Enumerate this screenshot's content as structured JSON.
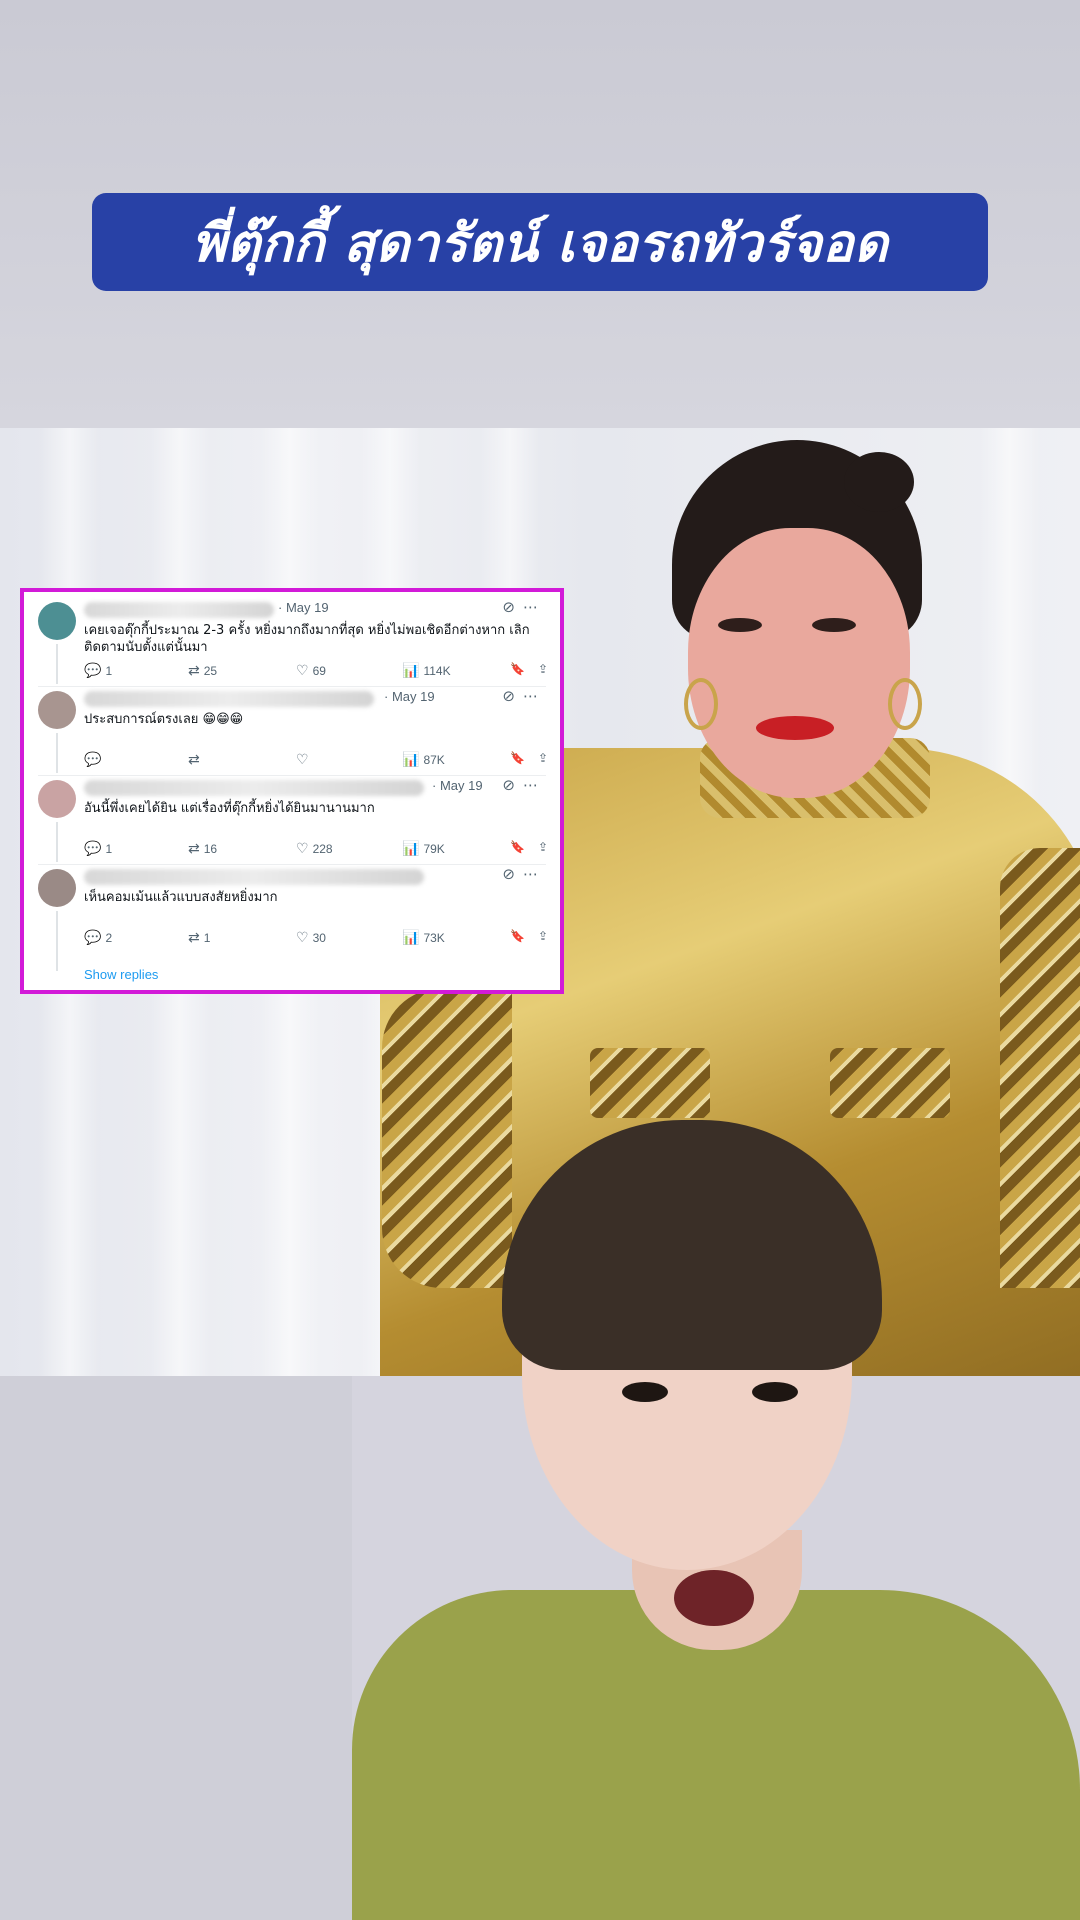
{
  "title": "พี่ตุ๊กกี้ สุดารัตน์ เจอรถทัวร์จอด",
  "comments": [
    {
      "date": "· May 19",
      "text": "เคยเจอตุ๊กกี้ประมาณ 2-3 ครั้ง หยิ่งมากถึงมากที่สุด หยิ่งไม่พอเชิดอีกต่างหาก เลิกติดตามนับตั้งแต่นั้นมา",
      "replies": "1",
      "reposts": "25",
      "likes": "69",
      "views": "114K",
      "avatar_color": "#4d8f93"
    },
    {
      "date": "· May 19",
      "text": "ประสบการณ์ตรงเลย 😁😁😁",
      "replies": "",
      "reposts": "",
      "likes": "",
      "views": "87K",
      "avatar_color": "#a89590"
    },
    {
      "date": "· May 19",
      "text": "อันนี้พึ่งเคยได้ยิน แต่เรื่องที่ตุ๊กกี้หยิ่งได้ยินมานานมาก",
      "replies": "1",
      "reposts": "16",
      "likes": "228",
      "views": "79K",
      "avatar_color": "#c9a3a3"
    },
    {
      "date": "",
      "text": "เห็นคอมเม้นแล้วแบบสงสัยหยิ่งมาก",
      "replies": "2",
      "reposts": "1",
      "likes": "30",
      "views": "73K",
      "avatar_color": "#9a8a86"
    }
  ],
  "show_replies": "Show replies",
  "icons": {
    "reply": "reply-icon",
    "repost": "repost-icon",
    "like": "heart-icon",
    "views": "views-icon",
    "bookmark": "bookmark-icon",
    "share": "share-icon",
    "grok": "grok-icon",
    "more": "more-icon"
  },
  "colors": {
    "banner": "#2841a6",
    "card_border": "#d21ad8",
    "link": "#1d9bf0"
  }
}
